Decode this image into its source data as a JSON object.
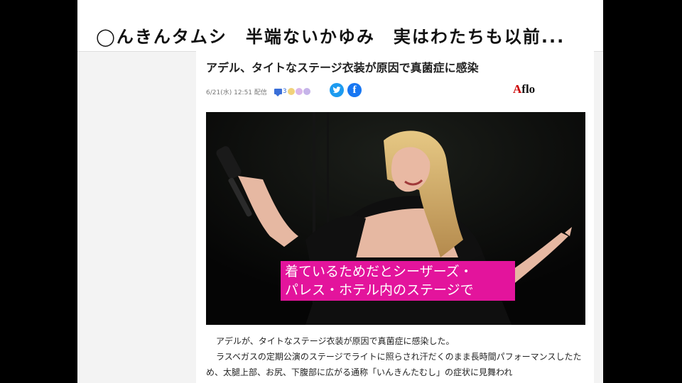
{
  "banner": {
    "text": "◯んきんタムシ　半端ないかゆみ　実はわたちも以前..."
  },
  "article": {
    "title": "アデル、タイトなステージ衣装が原因で真菌症に感染",
    "date": "6/21(水) 12:51 配信",
    "comment_count": "3",
    "credit_prefix": "A",
    "credit_rest": "flo",
    "caption_line1": "着ているためだとシーザーズ・",
    "caption_line2": "パレス・ホテル内のステージで",
    "paragraph1": "アデルが、タイトなステージ衣装が原因で真菌症に感染した。",
    "paragraph2": "ラスベガスの定期公演のステージでライトに照らされ汗だくのまま長時間パフォーマンスしたため、太腿上部、お尻、下腹部に広がる通称「いんきんたむし」の症状に見舞われ"
  },
  "icons": {
    "comment": "comment-icon",
    "twitter": "twitter-icon",
    "facebook": "facebook-icon"
  },
  "colors": {
    "caption_bg": "#e3149c",
    "twitter": "#1d9bf0",
    "facebook": "#1877f2",
    "comment": "#3a6fd8"
  }
}
